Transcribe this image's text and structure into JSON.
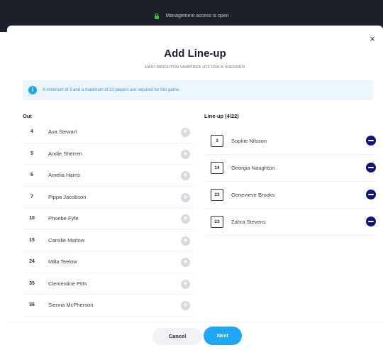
{
  "app_bar": {
    "management_text": "Management access is open",
    "lock_icon": "lock-icon",
    "lock_color": "#3cc24a"
  },
  "modal": {
    "close_label": "×",
    "title": "Add Line-up",
    "subtitle": "EAST BRIGHTON VAMPIRES U12 GIRLS SHERREN",
    "info_icon": "i",
    "info_text": "A minimum of 3 and a maximum of 22 players are required for this game.",
    "info_color": "#1fa3e6"
  },
  "out": {
    "heading": "Out",
    "players": [
      {
        "number": "4",
        "name": "Ava Stewart"
      },
      {
        "number": "5",
        "name": "Andie Sherren"
      },
      {
        "number": "6",
        "name": "Amelia Harris"
      },
      {
        "number": "7",
        "name": "Pippa Jacobson"
      },
      {
        "number": "10",
        "name": "Phoebe Fyfe"
      },
      {
        "number": "15",
        "name": "Camille Marlow"
      },
      {
        "number": "24",
        "name": "Milla Teelow"
      },
      {
        "number": "35",
        "name": "Clementine Pitts"
      },
      {
        "number": "36",
        "name": "Sienna McPherson"
      }
    ]
  },
  "lineup": {
    "heading": "Line-up (4/22)",
    "players": [
      {
        "number": "3",
        "name": "Sophie Nilsson"
      },
      {
        "number": "14",
        "name": "Georgia Naughton"
      },
      {
        "number": "23",
        "name": "Genevieve Brooks"
      },
      {
        "number": "23",
        "name": "Zahra Stevens"
      }
    ],
    "remove_color": "#12137a"
  },
  "footer": {
    "cancel_label": "Cancel",
    "next_label": "Next",
    "next_color": "#1ea7f2"
  }
}
